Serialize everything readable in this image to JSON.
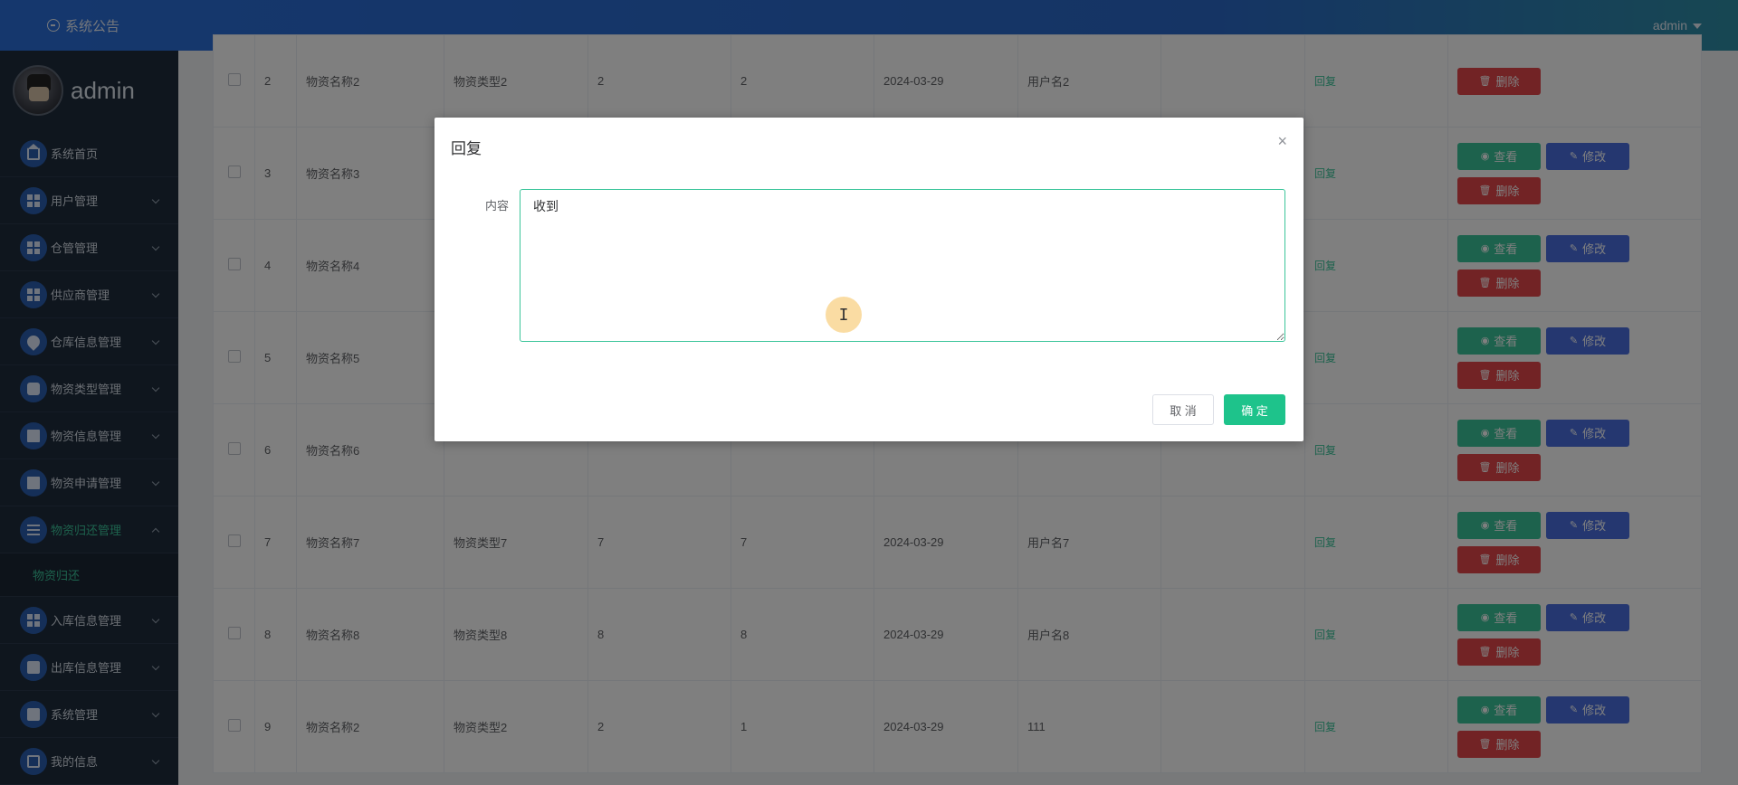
{
  "header": {
    "notice_label": "系统公告",
    "user_label": "admin"
  },
  "sidebar": {
    "profile_name": "admin",
    "items": [
      {
        "label": "系统首页",
        "icon": "home-icon"
      },
      {
        "label": "用户管理",
        "icon": "grid-icon"
      },
      {
        "label": "仓管管理",
        "icon": "grid-icon"
      },
      {
        "label": "供应商管理",
        "icon": "grid-icon"
      },
      {
        "label": "仓库信息管理",
        "icon": "pin-icon"
      },
      {
        "label": "物资类型管理",
        "icon": "chat-icon"
      },
      {
        "label": "物资信息管理",
        "icon": "book-icon"
      },
      {
        "label": "物资申请管理",
        "icon": "monitor-icon"
      },
      {
        "label": "物资归还管理",
        "icon": "list-icon"
      },
      {
        "label": "入库信息管理",
        "icon": "grid-icon"
      },
      {
        "label": "出库信息管理",
        "icon": "ticket-icon"
      },
      {
        "label": "系统管理",
        "icon": "clipboard-icon"
      },
      {
        "label": "我的信息",
        "icon": "card-icon"
      }
    ],
    "sub_item": "物资归还"
  },
  "table": {
    "reply_label": "回复",
    "view_label": "查看",
    "edit_label": "修改",
    "delete_label": "删除",
    "rows": [
      {
        "id": "2",
        "name": "物资名称2",
        "type": "物资类型2",
        "qty": "2",
        "ret": "2",
        "date": "2024-03-29",
        "user": "用户名2"
      },
      {
        "id": "3",
        "name": "物资名称3",
        "type": "",
        "qty": "",
        "ret": "",
        "date": "",
        "user": ""
      },
      {
        "id": "4",
        "name": "物资名称4",
        "type": "",
        "qty": "",
        "ret": "",
        "date": "",
        "user": ""
      },
      {
        "id": "5",
        "name": "物资名称5",
        "type": "",
        "qty": "",
        "ret": "",
        "date": "",
        "user": ""
      },
      {
        "id": "6",
        "name": "物资名称6",
        "type": "",
        "qty": "",
        "ret": "",
        "date": "",
        "user": ""
      },
      {
        "id": "7",
        "name": "物资名称7",
        "type": "物资类型7",
        "qty": "7",
        "ret": "7",
        "date": "2024-03-29",
        "user": "用户名7"
      },
      {
        "id": "8",
        "name": "物资名称8",
        "type": "物资类型8",
        "qty": "8",
        "ret": "8",
        "date": "2024-03-29",
        "user": "用户名8"
      },
      {
        "id": "9",
        "name": "物资名称2",
        "type": "物资类型2",
        "qty": "2",
        "ret": "1",
        "date": "2024-03-29",
        "user": "111"
      }
    ]
  },
  "dialog": {
    "title": "回复",
    "close_glyph": "×",
    "content_label": "内容",
    "content_value": "收到",
    "cursor_glyph": "I",
    "cancel_label": "取 消",
    "ok_label": "确 定"
  }
}
